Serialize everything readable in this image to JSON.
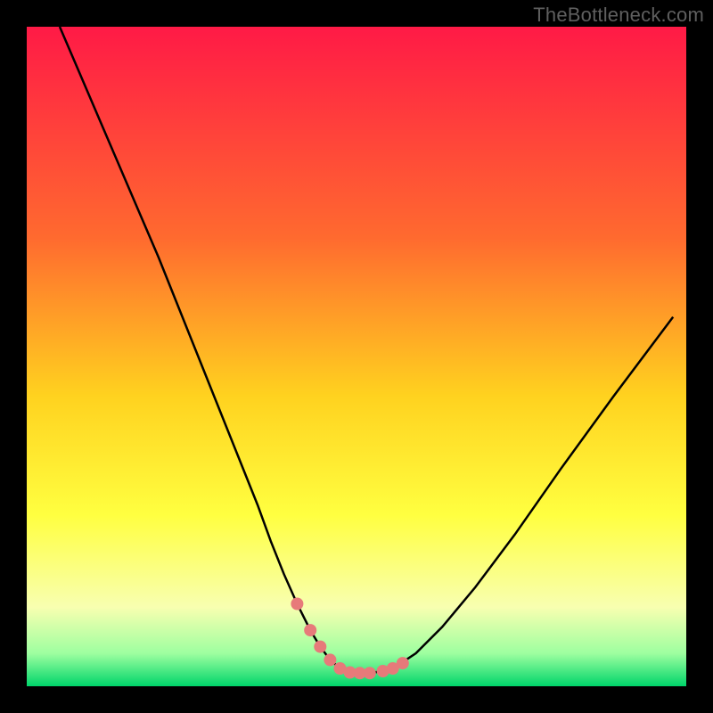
{
  "watermark": {
    "text": "TheBottleneck.com"
  },
  "colors": {
    "black": "#000000",
    "curve": "#000000",
    "marker": "#e77a7a",
    "grad_top": "#ff1a46",
    "grad_mid1": "#ff6a2f",
    "grad_mid2": "#ffd21f",
    "grad_mid3": "#ffff40",
    "grad_mid4": "#f8ffb0",
    "grad_mid5": "#9effa0",
    "grad_bottom": "#00d56a"
  },
  "chart_data": {
    "type": "line",
    "title": "",
    "xlabel": "",
    "ylabel": "",
    "xlim": [
      0,
      100
    ],
    "ylim": [
      0,
      100
    ],
    "series": [
      {
        "name": "bottleneck-curve",
        "x": [
          5,
          8,
          11,
          14,
          17,
          20,
          23,
          26,
          29,
          32,
          35,
          37,
          39,
          41,
          43,
          44.5,
          46,
          47.5,
          49,
          50.5,
          52,
          54,
          56,
          59,
          63,
          68,
          74,
          81,
          89,
          98
        ],
        "y": [
          100,
          93,
          86,
          79,
          72,
          65,
          57.5,
          50,
          42.5,
          35,
          27.5,
          22,
          17,
          12.5,
          8.5,
          6,
          4,
          2.7,
          2.1,
          2,
          2,
          2.3,
          3,
          5,
          9,
          15,
          23,
          33,
          44,
          56
        ]
      }
    ],
    "markers": {
      "name": "highlight-dots",
      "x": [
        41,
        43,
        44.5,
        46,
        47.5,
        49,
        50.5,
        52,
        54,
        55.5,
        57
      ],
      "y": [
        12.5,
        8.5,
        6,
        4,
        2.7,
        2.1,
        2,
        2,
        2.3,
        2.7,
        3.5
      ]
    }
  }
}
